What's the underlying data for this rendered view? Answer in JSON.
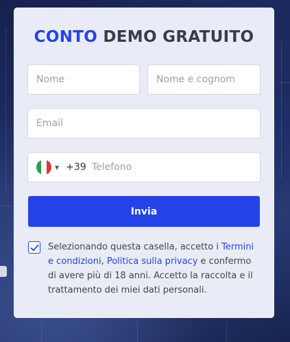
{
  "title": {
    "accent": "CONTO",
    "rest": "DEMO GRATUITO"
  },
  "form": {
    "first_name": {
      "placeholder": "Nome",
      "value": ""
    },
    "last_name": {
      "placeholder": "Nome e cognom",
      "value": ""
    },
    "email": {
      "placeholder": "Email",
      "value": ""
    },
    "phone": {
      "country_flag": "italy-flag",
      "dial_code": "+39",
      "placeholder": "Telefono",
      "value": ""
    },
    "submit_label": "Invia"
  },
  "consent": {
    "checked": true,
    "text_before": "Selezionando questa casella, accetto i ",
    "terms_link": "Termini e condizioni",
    "separator": ", ",
    "privacy_link": "Politica sulla privacy",
    "text_after": " e confermo di avere più di 18 anni. Accetto la raccolta e il trattamento dei miei dati personali."
  },
  "colors": {
    "accent": "#2342e8",
    "card": "#e9ecf7",
    "title_dark": "#3a3d47"
  }
}
